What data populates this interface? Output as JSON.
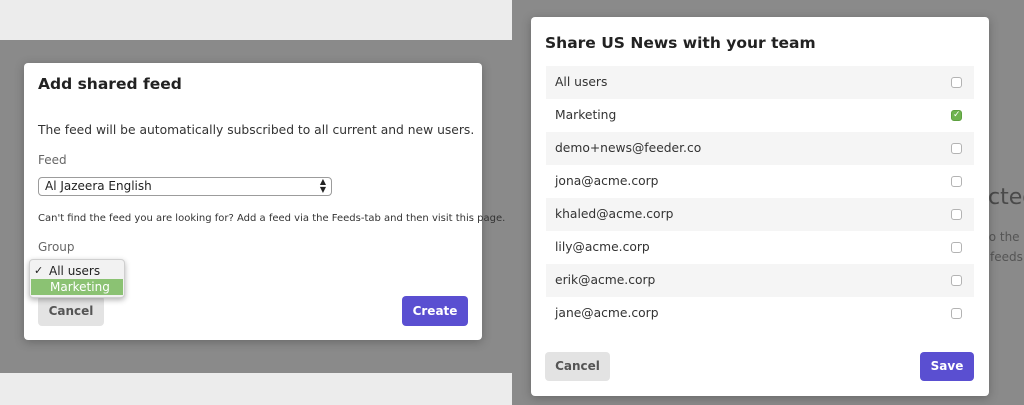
{
  "left": {
    "modal_title": "Add shared feed",
    "intro_text": "The feed will be automatically subscribed to all current and new users.",
    "feed_label": "Feed",
    "feed_value": "Al Jazeera English",
    "help_text": "Can't find the feed you are looking for? Add a feed via the Feeds-tab and then visit this page.",
    "group_label": "Group",
    "group_options": [
      {
        "label": "All users",
        "selected": true
      },
      {
        "label": "Marketing",
        "highlighted": true
      }
    ],
    "cancel_label": "Cancel",
    "create_label": "Create"
  },
  "right": {
    "modal_title": "Share US News with your team",
    "users": [
      {
        "label": "All users",
        "checked": false
      },
      {
        "label": "Marketing",
        "checked": true
      },
      {
        "label": "demo+news@feeder.co",
        "checked": false
      },
      {
        "label": "jona@acme.corp",
        "checked": false
      },
      {
        "label": "khaled@acme.corp",
        "checked": false
      },
      {
        "label": "lily@acme.corp",
        "checked": false
      },
      {
        "label": "erik@acme.corp",
        "checked": false
      },
      {
        "label": "jane@acme.corp",
        "checked": false
      }
    ],
    "cancel_label": "Cancel",
    "save_label": "Save",
    "background_peek": {
      "heading": "cted",
      "line1": "to the",
      "line2": "feeds"
    }
  },
  "colors": {
    "primary": "#5a4fd1",
    "check_green": "#6fb34f",
    "highlight_green": "#8bc273",
    "overlay": "#8a8a8a"
  },
  "icons": {
    "select_arrows": "up-down-arrows-icon",
    "checkmark": "checkmark-icon"
  }
}
